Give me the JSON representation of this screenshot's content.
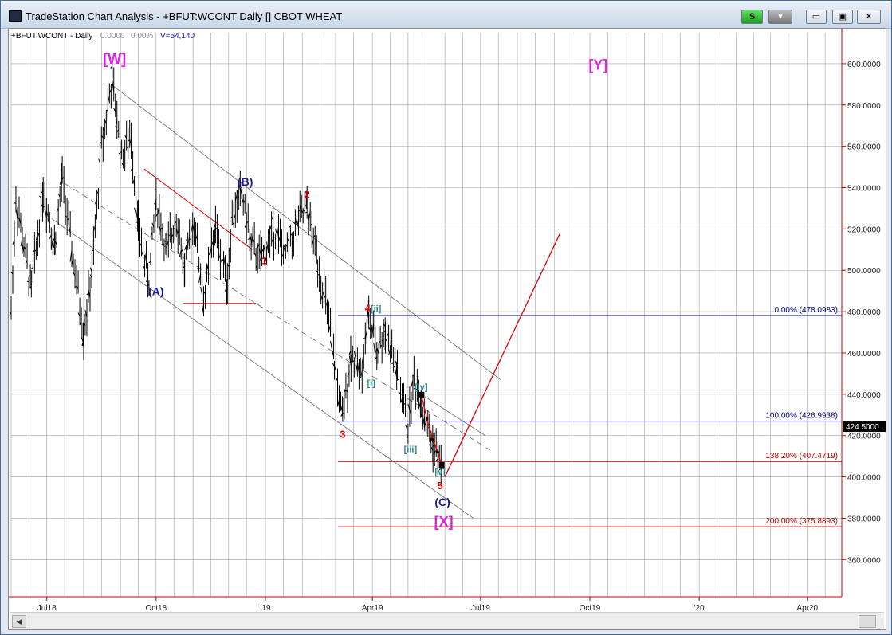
{
  "window": {
    "title": "TradeStation Chart Analysis - +BFUT:WCONT Daily [] CBOT WHEAT",
    "s_label": "S",
    "menu_label": "▾",
    "min_label": "▭",
    "max_label": "▣",
    "close_label": "✕"
  },
  "header": {
    "symbol": "+BFUT:WCONT - Daily",
    "v1": "0.0000",
    "v2": "0.00%",
    "volume": "V=54,140"
  },
  "colors": {
    "grid": "#a0a0a0",
    "price_axis": "#cc0000",
    "bars": "#000000",
    "magenta": "#e020e0",
    "blue_wave": "#1a1a99",
    "red_wave": "#dd0000",
    "teal_wave": "#2a8a8a",
    "fib_blue": "#000080",
    "fib_red": "#b00000",
    "channel": "#666666"
  },
  "chart_data": {
    "type": "ohlc",
    "title": "CBOT WHEAT",
    "symbol": "+BFUT:WCONT",
    "interval": "Daily",
    "ylim": [
      342,
      615
    ],
    "y_ticks": [
      "360.0000",
      "380.0000",
      "400.0000",
      "420.0000",
      "440.0000",
      "460.0000",
      "480.0000",
      "500.0000",
      "520.0000",
      "540.0000",
      "560.0000",
      "580.0000",
      "600.0000"
    ],
    "y_tick_values": [
      360,
      380,
      400,
      420,
      440,
      460,
      480,
      500,
      520,
      540,
      560,
      580,
      600
    ],
    "x_range": [
      "2018-06-01",
      "2020-04-30"
    ],
    "x_ticks": [
      {
        "label": "Jul18",
        "date": "2018-07-01"
      },
      {
        "label": "Oct18",
        "date": "2018-10-01"
      },
      {
        "label": "'19",
        "date": "2019-01-01"
      },
      {
        "label": "Apr19",
        "date": "2019-04-01"
      },
      {
        "label": "Jul19",
        "date": "2019-07-01"
      },
      {
        "label": "Oct19",
        "date": "2019-10-01"
      },
      {
        "label": "'20",
        "date": "2020-01-01"
      },
      {
        "label": "Apr20",
        "date": "2020-04-01"
      }
    ],
    "last_price": "424.5000",
    "price_path": [
      {
        "date": "2018-06-01",
        "value": 480
      },
      {
        "date": "2018-06-05",
        "value": 535
      },
      {
        "date": "2018-06-18",
        "value": 490
      },
      {
        "date": "2018-06-28",
        "value": 540
      },
      {
        "date": "2018-07-08",
        "value": 512
      },
      {
        "date": "2018-07-14",
        "value": 545
      },
      {
        "date": "2018-07-22",
        "value": 510
      },
      {
        "date": "2018-08-01",
        "value": 470
      },
      {
        "date": "2018-08-08",
        "value": 498
      },
      {
        "date": "2018-08-16",
        "value": 560
      },
      {
        "date": "2018-08-25",
        "value": 592
      },
      {
        "date": "2018-09-02",
        "value": 555
      },
      {
        "date": "2018-09-10",
        "value": 565
      },
      {
        "date": "2018-09-16",
        "value": 520
      },
      {
        "date": "2018-09-25",
        "value": 495
      },
      {
        "date": "2018-10-01",
        "value": 535
      },
      {
        "date": "2018-10-10",
        "value": 508
      },
      {
        "date": "2018-10-18",
        "value": 527
      },
      {
        "date": "2018-10-25",
        "value": 500
      },
      {
        "date": "2018-11-02",
        "value": 525
      },
      {
        "date": "2018-11-10",
        "value": 485
      },
      {
        "date": "2018-11-20",
        "value": 520
      },
      {
        "date": "2018-11-30",
        "value": 495
      },
      {
        "date": "2018-12-04",
        "value": 525
      },
      {
        "date": "2018-12-12",
        "value": 538
      },
      {
        "date": "2018-12-20",
        "value": 512
      },
      {
        "date": "2018-12-29",
        "value": 505
      },
      {
        "date": "2019-01-08",
        "value": 520
      },
      {
        "date": "2019-01-18",
        "value": 508
      },
      {
        "date": "2019-01-30",
        "value": 525
      },
      {
        "date": "2019-02-05",
        "value": 530
      },
      {
        "date": "2019-02-14",
        "value": 505
      },
      {
        "date": "2019-02-22",
        "value": 480
      },
      {
        "date": "2019-02-28",
        "value": 455
      },
      {
        "date": "2019-03-07",
        "value": 428
      },
      {
        "date": "2019-03-14",
        "value": 460
      },
      {
        "date": "2019-03-22",
        "value": 450
      },
      {
        "date": "2019-03-29",
        "value": 478
      },
      {
        "date": "2019-04-05",
        "value": 460
      },
      {
        "date": "2019-04-12",
        "value": 472
      },
      {
        "date": "2019-04-22",
        "value": 450
      },
      {
        "date": "2019-05-01",
        "value": 425
      },
      {
        "date": "2019-05-06",
        "value": 447
      },
      {
        "date": "2019-05-12",
        "value": 438
      },
      {
        "date": "2019-05-15",
        "value": 428
      },
      {
        "date": "2019-05-22",
        "value": 416
      },
      {
        "date": "2019-05-29",
        "value": 406
      }
    ],
    "projections": [
      {
        "name": "5-wave-path",
        "color": "red_wave",
        "points": [
          {
            "date": "2019-05-12",
            "value": 440
          },
          {
            "date": "2019-05-17",
            "value": 428
          },
          {
            "date": "2019-05-22",
            "value": 418
          },
          {
            "date": "2019-05-26",
            "value": 412
          },
          {
            "date": "2019-05-29",
            "value": 406
          }
        ]
      },
      {
        "name": "projection-up",
        "color": "red_wave",
        "points": [
          {
            "date": "2019-06-01",
            "value": 400
          },
          {
            "date": "2019-09-06",
            "value": 518
          }
        ]
      }
    ],
    "channels": [
      {
        "dash": false,
        "points": [
          {
            "date": "2018-08-24",
            "value": 590
          },
          {
            "date": "2019-07-18",
            "value": 447
          }
        ]
      },
      {
        "dash": true,
        "points": [
          {
            "date": "2018-07-16",
            "value": 542
          },
          {
            "date": "2019-07-09",
            "value": 413
          }
        ]
      },
      {
        "dash": false,
        "points": [
          {
            "date": "2018-07-05",
            "value": 525
          },
          {
            "date": "2019-06-25",
            "value": 380
          }
        ]
      },
      {
        "dash": false,
        "points": [
          {
            "date": "2019-05-12",
            "value": 440
          },
          {
            "date": "2019-07-05",
            "value": 420
          }
        ]
      }
    ],
    "trendlines": [
      {
        "color": "red_wave",
        "points": [
          {
            "date": "2018-09-21",
            "value": 549
          },
          {
            "date": "2018-12-21",
            "value": 510
          }
        ]
      },
      {
        "color": "red_wave",
        "points": [
          {
            "date": "2018-10-24",
            "value": 484
          },
          {
            "date": "2018-12-24",
            "value": 484
          }
        ]
      }
    ],
    "fib_levels": [
      {
        "label": "0.00% (478.0983)",
        "value": 478.0983,
        "color": "fib_blue",
        "start": "2019-03-03"
      },
      {
        "label": "100.00% (426.9938)",
        "value": 426.9938,
        "color": "fib_blue",
        "start": "2019-03-03"
      },
      {
        "label": "138.20% (407.4719)",
        "value": 407.4719,
        "color": "fib_red",
        "start": "2019-03-03"
      },
      {
        "label": "200.00% (375.8893)",
        "value": 375.8893,
        "color": "fib_red",
        "start": "2019-03-03"
      }
    ],
    "wave_labels": [
      {
        "text": "[W]",
        "date": "2018-08-27",
        "value": 600,
        "color": "magenta",
        "size": 18
      },
      {
        "text": "[Y]",
        "date": "2019-10-08",
        "value": 597,
        "color": "magenta",
        "size": 18
      },
      {
        "text": "(B)",
        "date": "2018-12-15",
        "value": 541,
        "color": "blue_wave",
        "size": 14
      },
      {
        "text": "(A)",
        "date": "2018-10-01",
        "value": 488,
        "color": "blue_wave",
        "size": 14
      },
      {
        "text": "2",
        "date": "2019-02-05",
        "value": 535,
        "color": "red_wave",
        "size": 13
      },
      {
        "text": "1",
        "date": "2018-12-31",
        "value": 503,
        "color": "red_wave",
        "size": 13
      },
      {
        "text": "4",
        "date": "2019-03-28",
        "value": 480,
        "color": "red_wave",
        "size": 13
      },
      {
        "text": "[ii]",
        "date": "2019-04-04",
        "value": 480,
        "color": "teal_wave",
        "size": 11
      },
      {
        "text": "[i]",
        "date": "2019-03-31",
        "value": 444,
        "color": "teal_wave",
        "size": 11
      },
      {
        "text": "[iv]",
        "date": "2019-05-12",
        "value": 442,
        "color": "teal_wave",
        "size": 11
      },
      {
        "text": "3",
        "date": "2019-03-07",
        "value": 419,
        "color": "red_wave",
        "size": 13
      },
      {
        "text": "[iii]",
        "date": "2019-05-03",
        "value": 412,
        "color": "teal_wave",
        "size": 11
      },
      {
        "text": "[v]",
        "date": "2019-05-28",
        "value": 401,
        "color": "teal_wave",
        "size": 11
      },
      {
        "text": "5",
        "date": "2019-05-28",
        "value": 394,
        "color": "red_wave",
        "size": 13
      },
      {
        "text": "(C)",
        "date": "2019-05-30",
        "value": 386,
        "color": "blue_wave",
        "size": 14
      },
      {
        "text": "[X]",
        "date": "2019-05-31",
        "value": 376,
        "color": "magenta",
        "size": 18
      }
    ]
  }
}
